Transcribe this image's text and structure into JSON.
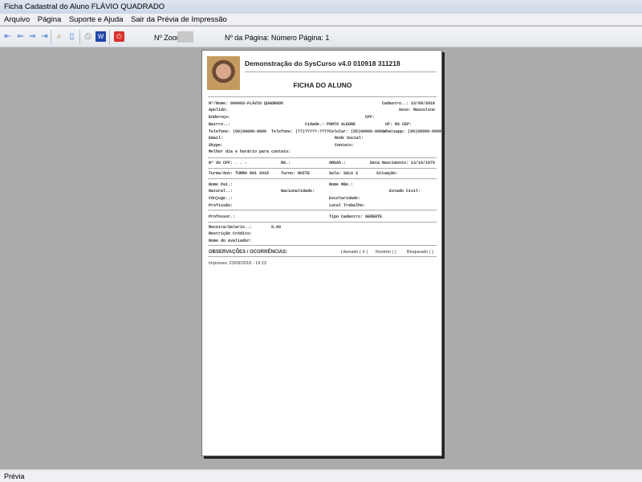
{
  "window": {
    "title": "Ficha Cadastral do Aluno FLÁVIO QUADRADO"
  },
  "menu": [
    "Arquivo",
    "Página",
    "Suporte e Ajuda",
    "Sair da Prévia de Impressão"
  ],
  "toolbar": {
    "zoom_label": "Nº Zoom",
    "page_label": "Nº da Página: Número Página: 1"
  },
  "status": "Prévia",
  "report": {
    "header": "Demonstração do SysCurso v4.0 010918 311218",
    "title": "FICHA DO ALUNO",
    "nome": "Nº/Nome: 000003-FLÁVIO QUADRADO",
    "cadastro": "Cadastro..: 23/09/2018",
    "apelido": "Apelido:",
    "sexo": "Sexo: Masculino",
    "endereco": "Endereço:",
    "cpf": "CPF:",
    "bairro": "Bairro..:",
    "cidade": "Cidade.: PORTO ALEGRE",
    "uf": "UF: RS  CEP:",
    "telefone1": "Telefone: (00)00000-0000",
    "telefone2": "Telefone: (77)?????-????",
    "celular": "Celular: (55)00000-0000",
    "whatsapp": "Whatsapp: (99)99999-9999",
    "email": "Email:",
    "rede": "Rede Social:",
    "skype": "Skype:",
    "contato": "Contato:",
    "melhor": "Melhor dia e horário para contato:",
    "ncpf": "Nº do CPF:    .   .   -",
    "rg": "RG.:",
    "orgao": "ORGAO.:",
    "nascimento": "Data Nascimento: 13/10/1979",
    "turma": "Turma/Ano: TURMA 801 2018",
    "turno": "Turno: NOITE",
    "sala": "Sala: SALA 3",
    "situacao": "Situação:",
    "pai": "Nome Pai.:",
    "mae": "Nome Mãe.:",
    "natural": "Natural..:",
    "nacionalidade": "Nacionalidade:",
    "civil": "Estado Civil:",
    "conjuge": "Cônjuge..:",
    "escolaridade": "Escolaridade:",
    "profissao": "Profissão:",
    "trabalho": "Local Trabalho:",
    "professor": "Professor.:",
    "tipo": "Tipo Cadastro: GERENTE",
    "receita": "Receita/Salario..:",
    "receita_val": "0,00",
    "restricao": "Restrição Crédito:",
    "avaliador": "Nome do Avaliador:",
    "obs": "OBSERVAÇÕES / OCORRÊNCIAS:",
    "liberado": "Liberado ( X )",
    "restrito": "Restrito (  )",
    "bloqueado": "Bloqueado (  )",
    "impresso": "Impresso: 23/09/2018 - 19:13"
  }
}
